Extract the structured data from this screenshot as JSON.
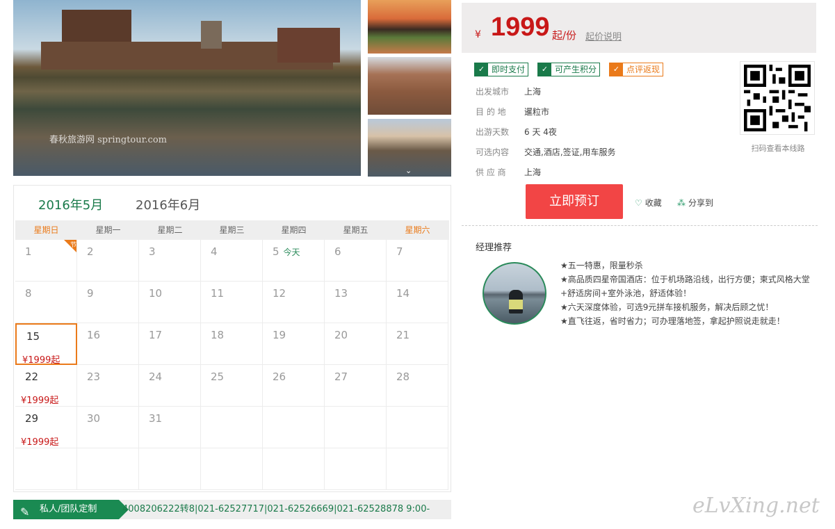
{
  "photos": {
    "watermark": "春秋旅游网 springtour.com"
  },
  "calendar": {
    "tabs": [
      {
        "label": "2016年5月",
        "active": true
      },
      {
        "label": "2016年6月",
        "active": false
      }
    ],
    "weekdays": [
      "星期日",
      "星期一",
      "星期二",
      "星期三",
      "星期四",
      "星期五",
      "星期六"
    ],
    "today_label": "今天",
    "holiday_tag": "节",
    "days": [
      {
        "day": "1",
        "holiday": true
      },
      {
        "day": "2"
      },
      {
        "day": "3"
      },
      {
        "day": "4"
      },
      {
        "day": "5",
        "today": true
      },
      {
        "day": "6"
      },
      {
        "day": "7"
      },
      {
        "day": "8"
      },
      {
        "day": "9"
      },
      {
        "day": "10"
      },
      {
        "day": "11"
      },
      {
        "day": "12"
      },
      {
        "day": "13"
      },
      {
        "day": "14"
      },
      {
        "day": "15",
        "price": "¥1999起",
        "selected": true
      },
      {
        "day": "16"
      },
      {
        "day": "17"
      },
      {
        "day": "18"
      },
      {
        "day": "19"
      },
      {
        "day": "20"
      },
      {
        "day": "21"
      },
      {
        "day": "22",
        "price": "¥1999起"
      },
      {
        "day": "23"
      },
      {
        "day": "24"
      },
      {
        "day": "25"
      },
      {
        "day": "26"
      },
      {
        "day": "27"
      },
      {
        "day": "28"
      },
      {
        "day": "29",
        "price": "¥1999起"
      },
      {
        "day": "30"
      },
      {
        "day": "31"
      }
    ]
  },
  "custom_bar": {
    "tag": "私人/团队定制",
    "phones": "4008206222转8|021-62527717|021-62526669|021-62528878  9:00-"
  },
  "price": {
    "currency": "¥",
    "amount": "1999",
    "unit": "起/份",
    "explain": "起价说明"
  },
  "badges": [
    "即时支付",
    "可产生积分",
    "点评返现"
  ],
  "info": [
    {
      "key": "出发城市",
      "value": "上海"
    },
    {
      "key": "目 的 地",
      "value": "暹粒市"
    },
    {
      "key": "出游天数",
      "value": "6 天 4夜"
    },
    {
      "key": "可选内容",
      "value": "交通,酒店,签证,用车服务"
    },
    {
      "key": "供 应 商",
      "value": "上海"
    }
  ],
  "qr": {
    "caption": "扫码查看本线路"
  },
  "actions": {
    "book": "立即预订",
    "favorite": "收藏",
    "share": "分享到"
  },
  "manager": {
    "title": "经理推荐",
    "lines": [
      "★五一特惠，限量秒杀",
      "★高品质四星帝国酒店：位于机场路沿线，出行方便；柬式风格大堂",
      "+舒适房间+室外泳池，舒适体验！",
      "★六天深度体验，可选9元拼车接机服务，解决后顾之忧！",
      "★直飞往返，省时省力；可办理落地签，拿起护照说走就走！"
    ]
  },
  "brand": "eLvXing.net",
  "colors": {
    "accent_green": "#1a7a4a",
    "price_red": "#c81818",
    "book_red": "#f24545",
    "orange": "#ea7a1a"
  }
}
